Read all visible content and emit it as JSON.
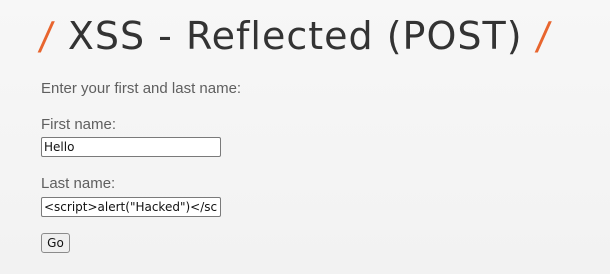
{
  "header": {
    "slash_left": "/",
    "title": "XSS - Reflected (POST)",
    "slash_right": "/"
  },
  "form": {
    "intro": "Enter your first and last name:",
    "first_name_label": "First name:",
    "first_name_value": "Hello",
    "last_name_label": "Last name:",
    "last_name_value": "<script>alert(\"Hacked\")</scr",
    "submit_label": "Go"
  },
  "colors": {
    "accent": "#e8652e",
    "text": "#5f5f5f",
    "background": "#f5f5f5"
  }
}
